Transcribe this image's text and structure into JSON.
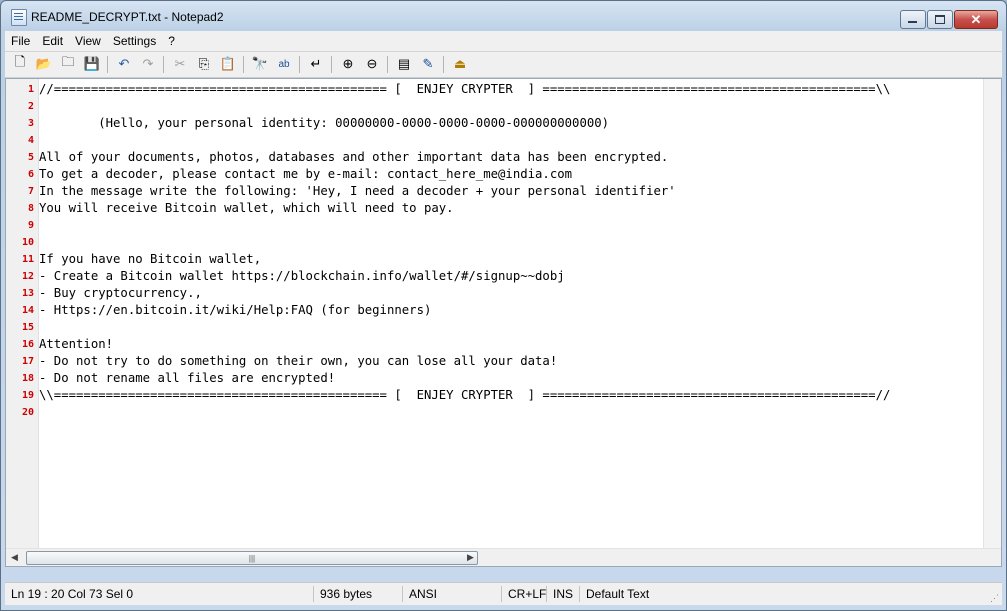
{
  "window": {
    "title": "README_DECRYPT.txt - Notepad2"
  },
  "menu": [
    "File",
    "Edit",
    "View",
    "Settings",
    "?"
  ],
  "toolbar": [
    {
      "icon": "new-file-icon",
      "glyph": "🗋"
    },
    {
      "icon": "open-folder-icon",
      "glyph": "📂"
    },
    {
      "icon": "browse-icon",
      "glyph": "🗀"
    },
    {
      "icon": "save-icon",
      "glyph": "💾"
    },
    {
      "icon": "undo-icon",
      "glyph": "↶"
    },
    {
      "icon": "redo-icon",
      "glyph": "↷"
    },
    {
      "icon": "cut-icon",
      "glyph": "✂"
    },
    {
      "icon": "copy-icon",
      "glyph": "⎘"
    },
    {
      "icon": "paste-icon",
      "glyph": "📋"
    },
    {
      "icon": "find-icon",
      "glyph": "🔭"
    },
    {
      "icon": "replace-icon",
      "glyph": "ab"
    },
    {
      "icon": "word-wrap-icon",
      "glyph": "↵"
    },
    {
      "icon": "zoom-in-icon",
      "glyph": "⊕"
    },
    {
      "icon": "zoom-out-icon",
      "glyph": "⊖"
    },
    {
      "icon": "scheme-icon",
      "glyph": "▤"
    },
    {
      "icon": "customize-icon",
      "glyph": "✎"
    },
    {
      "icon": "exit-icon",
      "glyph": "⏏"
    }
  ],
  "editor": {
    "lines": [
      "//============================================= [  ENJEY CRYPTER  ] =============================================\\\\",
      "",
      "        (Hello, your personal identity: 00000000-0000-0000-0000-000000000000)",
      "",
      "All of your documents, photos, databases and other important data has been encrypted.",
      "To get a decoder, please contact me by e-mail: contact_here_me@india.com",
      "In the message write the following: 'Hey, I need a decoder + your personal identifier'",
      "You will receive Bitcoin wallet, which will need to pay.",
      "",
      "",
      "If you have no Bitcoin wallet,",
      "- Create a Bitcoin wallet https://blockchain.info/wallet/#/signup~~dobj",
      "- Buy cryptocurrency.,",
      "- Https://en.bitcoin.it/wiki/Help:FAQ (for beginners)",
      "",
      "Attention!",
      "- Do not try to do something on their own, you can lose all your data!",
      "- Do not rename all files are encrypted!",
      "\\\\============================================= [  ENJEY CRYPTER  ] =============================================//",
      ""
    ]
  },
  "status": {
    "position": "Ln 19 : 20   Col 73   Sel 0",
    "size": "936 bytes",
    "encoding": "ANSI",
    "eol": "CR+LF",
    "mode": "INS",
    "scheme": "Default Text"
  }
}
